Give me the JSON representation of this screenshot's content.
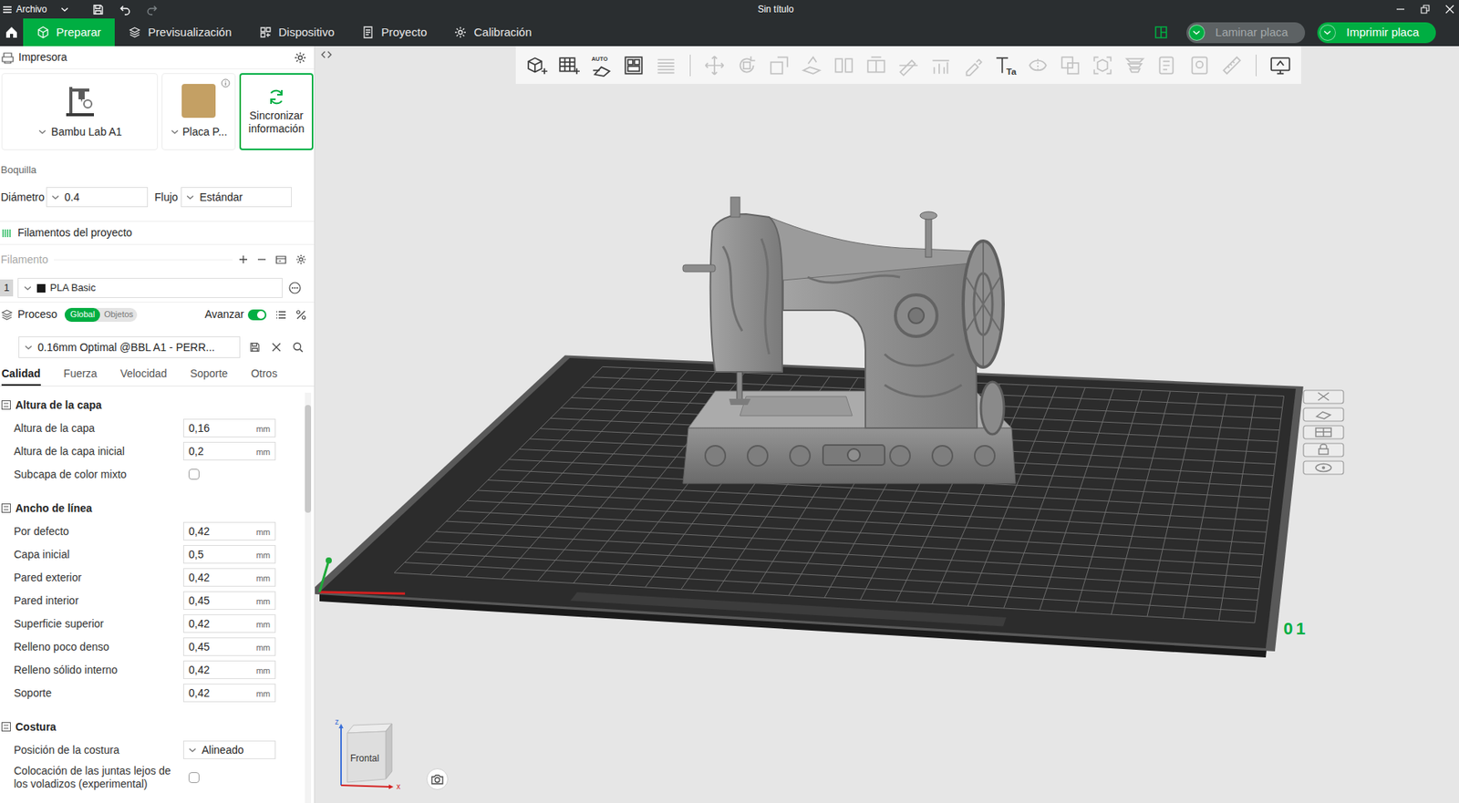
{
  "window": {
    "menu_label": "Archivo",
    "title": "Sin título",
    "redo_disabled": true
  },
  "nav": {
    "tabs": [
      {
        "label": "Preparar",
        "selected": true
      },
      {
        "label": "Previsualización",
        "selected": false
      },
      {
        "label": "Dispositivo",
        "selected": false
      },
      {
        "label": "Proyecto",
        "selected": false
      },
      {
        "label": "Calibración",
        "selected": false
      }
    ],
    "buttons": [
      {
        "label": "Laminar placa",
        "disabled": true
      },
      {
        "label": "Imprimir placa",
        "disabled": false
      }
    ]
  },
  "printer": {
    "title": "Impresora",
    "printer_name": "Bambu Lab A1",
    "plate_name": "Placa P...",
    "sync_label": "Sincronizar información"
  },
  "nozzle": {
    "title": "Boquilla",
    "diameter_label": "Diámetro",
    "diameter": "0.4",
    "flow_label": "Flujo",
    "flow": "Estándar"
  },
  "filaments": {
    "title": "Filamentos del proyecto",
    "label": "Filamento",
    "items": [
      {
        "index": "1",
        "name": "PLA Basic",
        "color": "#1a1a1a"
      }
    ]
  },
  "process": {
    "title": "Proceso",
    "scopes": [
      {
        "label": "Global",
        "selected": true
      },
      {
        "label": "Objetos",
        "selected": false
      }
    ],
    "advanced_label": "Avanzar",
    "advanced_on": true,
    "preset": "0.16mm Optimal @BBL A1 - PERR...",
    "tabs": [
      {
        "label": "Calidad",
        "selected": true
      },
      {
        "label": "Fuerza",
        "selected": false
      },
      {
        "label": "Velocidad",
        "selected": false
      },
      {
        "label": "Soporte",
        "selected": false
      },
      {
        "label": "Otros",
        "selected": false
      }
    ],
    "sections": [
      {
        "title": "Altura de la capa",
        "rows": [
          {
            "kind": "number",
            "label": "Altura de la capa",
            "value": "0,16",
            "unit": "mm"
          },
          {
            "kind": "number",
            "label": "Altura de la capa inicial",
            "value": "0,2",
            "unit": "mm"
          },
          {
            "kind": "checkbox",
            "label": "Subcapa de color mixto",
            "checked": false
          }
        ]
      },
      {
        "title": "Ancho de línea",
        "rows": [
          {
            "kind": "number",
            "label": "Por defecto",
            "value": "0,42",
            "unit": "mm"
          },
          {
            "kind": "number",
            "label": "Capa inicial",
            "value": "0,5",
            "unit": "mm"
          },
          {
            "kind": "number",
            "label": "Pared exterior",
            "value": "0,42",
            "unit": "mm"
          },
          {
            "kind": "number",
            "label": "Pared interior",
            "value": "0,45",
            "unit": "mm"
          },
          {
            "kind": "number",
            "label": "Superficie superior",
            "value": "0,42",
            "unit": "mm"
          },
          {
            "kind": "number",
            "label": "Relleno poco denso",
            "value": "0,45",
            "unit": "mm"
          },
          {
            "kind": "number",
            "label": "Relleno sólido interno",
            "value": "0,42",
            "unit": "mm"
          },
          {
            "kind": "number",
            "label": "Soporte",
            "value": "0,42",
            "unit": "mm"
          }
        ]
      },
      {
        "title": "Costura",
        "rows": [
          {
            "kind": "dropdown",
            "label": "Posición de la costura",
            "value": "Alineado"
          },
          {
            "kind": "checkbox",
            "label": "Colocación de las juntas lejos de los voladizos (experimental)",
            "checked": false
          }
        ]
      }
    ]
  },
  "toolbar": [
    {
      "kind": "add-object",
      "disabled": false
    },
    {
      "kind": "add-plate",
      "disabled": false
    },
    {
      "kind": "auto-orient",
      "disabled": false,
      "text": "AUTO"
    },
    {
      "kind": "arrange",
      "disabled": false
    },
    {
      "kind": "layers",
      "disabled": true
    },
    {
      "kind": "separator",
      "disabled": false
    },
    {
      "kind": "move",
      "disabled": true
    },
    {
      "kind": "rotate",
      "disabled": true
    },
    {
      "kind": "scale",
      "disabled": true
    },
    {
      "kind": "lay-flat",
      "disabled": true
    },
    {
      "kind": "split-objects",
      "disabled": true
    },
    {
      "kind": "split-parts",
      "disabled": true
    },
    {
      "kind": "cut",
      "disabled": true
    },
    {
      "kind": "support-paint",
      "disabled": true
    },
    {
      "kind": "color-paint",
      "disabled": true
    },
    {
      "kind": "text",
      "disabled": false,
      "text": "Ta"
    },
    {
      "kind": "seam-paint",
      "disabled": true
    },
    {
      "kind": "boolean",
      "disabled": true
    },
    {
      "kind": "bounding",
      "disabled": true
    },
    {
      "kind": "variable-height",
      "disabled": true
    },
    {
      "kind": "brim-ears",
      "disabled": true
    },
    {
      "kind": "placeholder",
      "disabled": true
    },
    {
      "kind": "measure",
      "disabled": true
    },
    {
      "kind": "separator",
      "disabled": false
    },
    {
      "kind": "assembly",
      "disabled": false
    }
  ],
  "viewport": {
    "plate_number": "01",
    "view_cube": {
      "face": "Frontal",
      "axes": [
        "z",
        "x"
      ]
    }
  }
}
